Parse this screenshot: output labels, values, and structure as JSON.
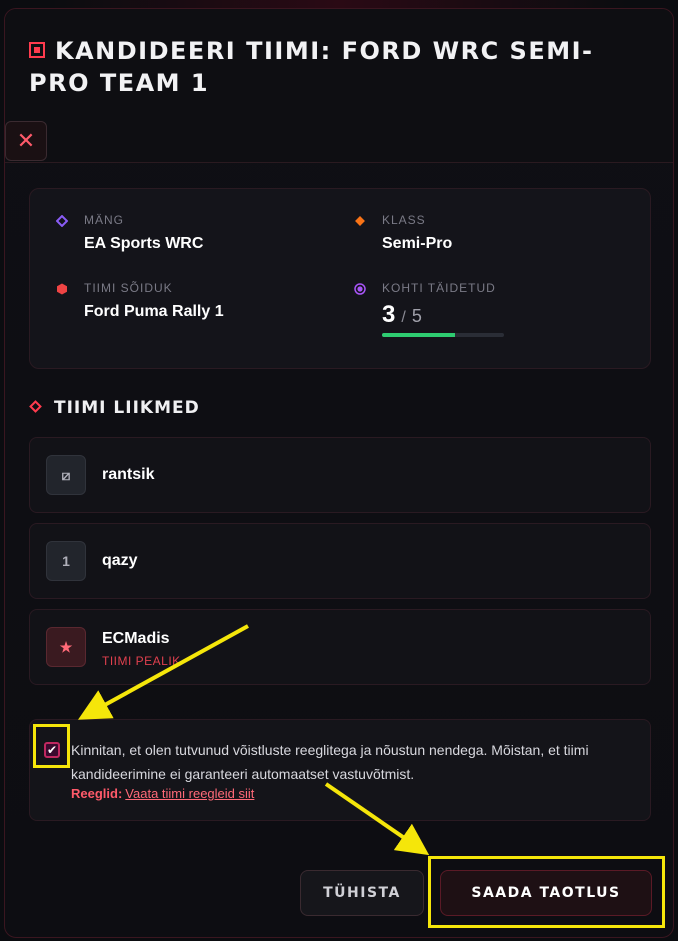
{
  "modal": {
    "title": "Kandideeri tiimi: Ford WRC Semi-Pro Team 1",
    "close_symbol": "✕"
  },
  "info": {
    "game_label": "Mäng",
    "game_value": "EA Sports WRC",
    "class_label": "Klass",
    "class_value": "Semi-Pro",
    "vehicle_label": "Tiimi sõiduk",
    "vehicle_value": "Ford Puma Rally 1",
    "slots_label": "Kohti täidetud",
    "slots_filled": "3",
    "slots_separator": "/",
    "slots_total": "5",
    "slots_progress": 0.6
  },
  "members": {
    "title": "Tiimi liikmed",
    "items": [
      {
        "badge": "⧄",
        "name": "rantsik"
      },
      {
        "badge": "1",
        "name": "qazy"
      },
      {
        "badge": "★",
        "name": "ECMadis",
        "role": "Tiimi pealik"
      }
    ]
  },
  "agreement": {
    "checked": true,
    "check_symbol": "✔",
    "text": "Kinnitan, et olen tutvunud võistluste reeglitega ja nõustun nendega. Mõistan, et tiimi kandideerimine ei garanteeri automaatset vastuvõtmist.",
    "rules_label": "Reeglid:",
    "rules_link": "Vaata tiimi reegleid siit"
  },
  "buttons": {
    "cancel": "Tühista",
    "submit": "Saada taotlus"
  },
  "colors": {
    "accent": "#ff3b4e",
    "game_icon": "#8a5cf6",
    "class_icon": "#f97316",
    "vehicle_icon": "#ef4444",
    "slots_icon": "#a855f7",
    "progress": "#2ecc71",
    "annotation": "#f5e60a"
  },
  "icons": {
    "title": "stop-square-icon",
    "close": "close-icon",
    "game": "diamond-icon",
    "class": "diamond-icon",
    "vehicle": "hexagon-icon",
    "slots": "circle-dot-icon",
    "section": "diamond-outline-icon"
  }
}
